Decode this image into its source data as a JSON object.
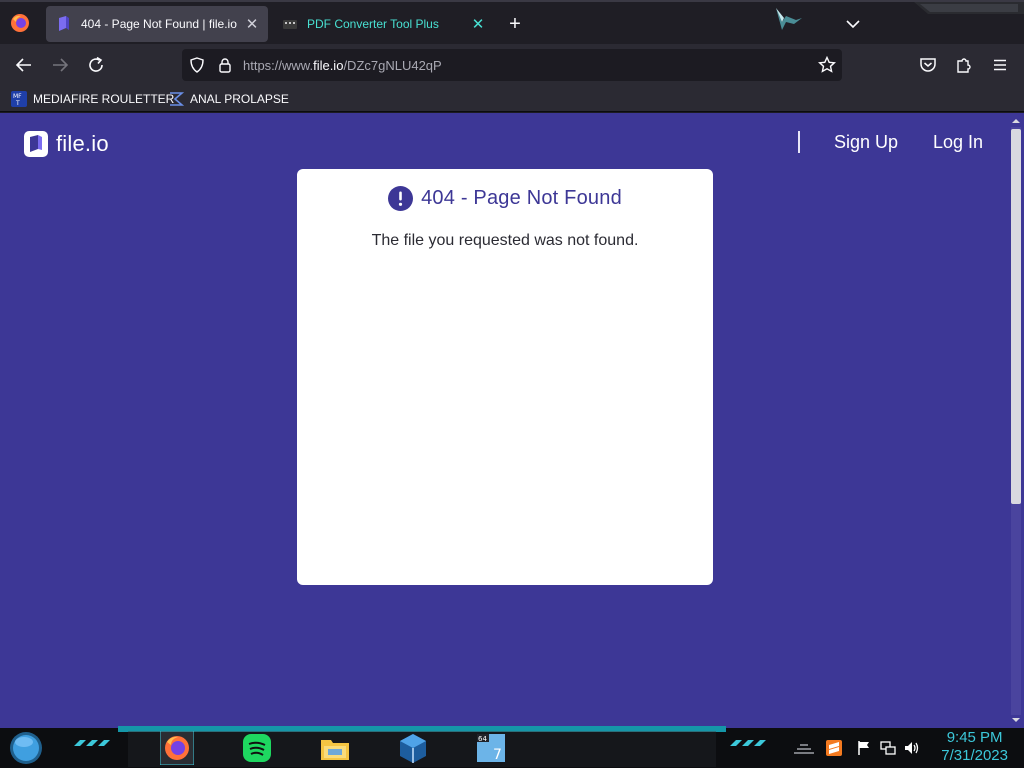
{
  "browser": {
    "tabs": [
      {
        "title": "404 - Page Not Found | file.io",
        "active": true,
        "favicon": "fileio-favicon"
      },
      {
        "title": "PDF Converter Tool Plus",
        "active": false,
        "favicon": "pdf-converter-favicon"
      }
    ],
    "new_tab_label": "+",
    "url_scheme": "https://www.",
    "url_host": "file.io",
    "url_path": "/DZc7gNLU42qP",
    "bookmarks": [
      {
        "label": "MEDIAFIRE ROULETTER",
        "icon": "mediafire-icon"
      },
      {
        "label": "ANAL PROLAPSE",
        "icon": "sigma-icon"
      }
    ]
  },
  "site": {
    "logo_text": "file.io",
    "nav": {
      "signup": "Sign Up",
      "login": "Log In"
    },
    "error": {
      "title": "404 - Page Not Found",
      "message": "The file you requested was not found."
    }
  },
  "taskbar": {
    "time": "9:45 PM",
    "date": "7/31/2023",
    "apps": [
      "firefox-icon",
      "spotify-icon",
      "file-explorer-icon",
      "virtualbox-icon",
      "windows7-64-icon"
    ],
    "tray": [
      "sublime-icon",
      "action-center-flag-icon",
      "network-icon",
      "volume-icon"
    ]
  },
  "colors": {
    "page_bg": "#3d3796",
    "card_bg": "#ffffff",
    "accent": "#3d3796",
    "tab_accent": "#48e0d2",
    "clock": "#3cc8da"
  }
}
